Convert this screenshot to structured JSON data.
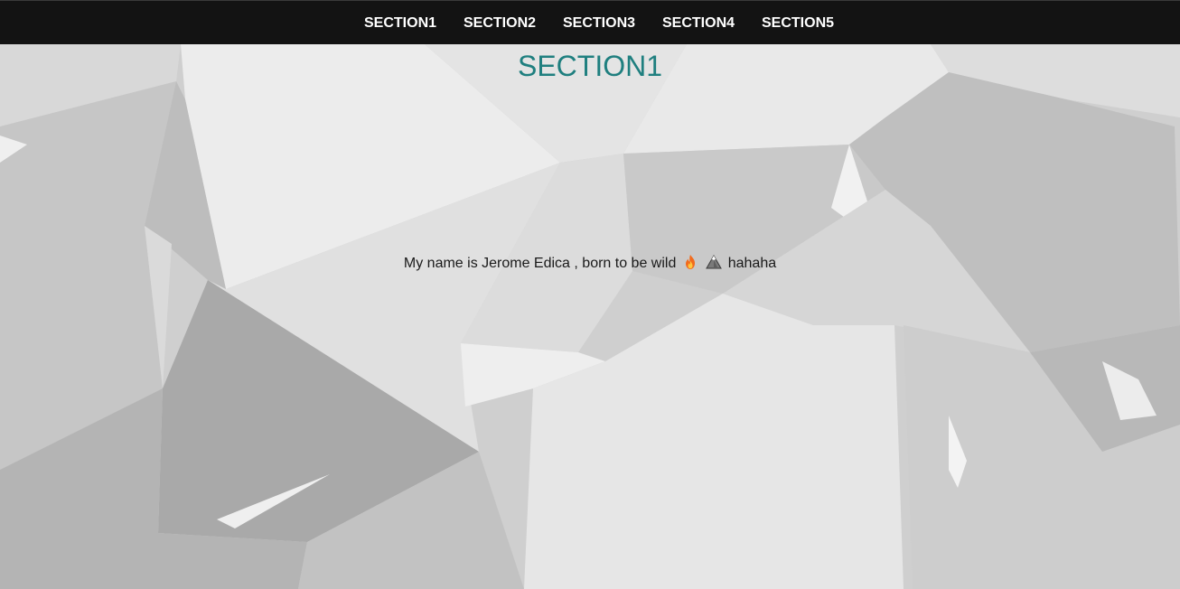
{
  "nav": {
    "items": [
      {
        "label": "SECTION1"
      },
      {
        "label": "SECTION2"
      },
      {
        "label": "SECTION3"
      },
      {
        "label": "SECTION4"
      },
      {
        "label": "SECTION5"
      }
    ]
  },
  "section": {
    "title": "SECTION1",
    "bio_text": "My name is Jerome Edica , born to be wild",
    "bio_suffix": "hahaha",
    "bio_icons": [
      "fire-icon",
      "mountain-icon"
    ]
  },
  "colors": {
    "navbar": "#131313",
    "nav_text": "#ffffff",
    "title": "#1f7f7f",
    "body_text": "#1a1a1a",
    "background": "#d4d4d4"
  }
}
